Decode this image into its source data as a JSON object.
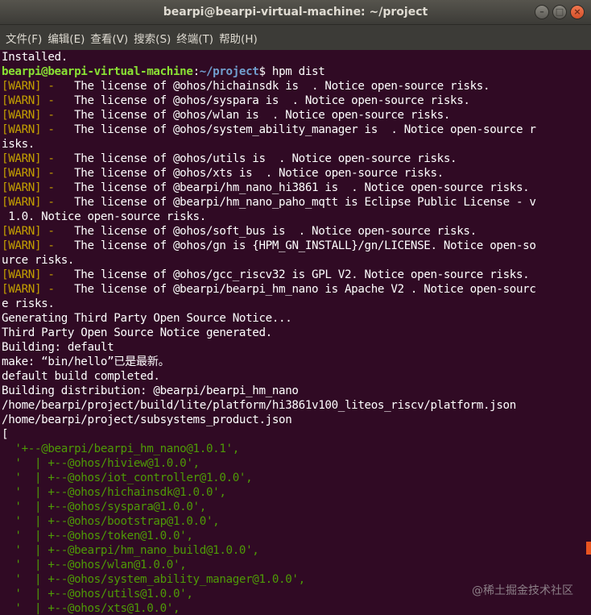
{
  "window": {
    "title": "bearpi@bearpi-virtual-machine: ~/project",
    "minimize_symbol": "–",
    "maximize_symbol": "□",
    "close_symbol": "×"
  },
  "menu": [
    "文件(F)",
    "编辑(E)",
    "查看(V)",
    "搜索(S)",
    "终端(T)",
    "帮助(H)"
  ],
  "colors": {
    "background": "#300a24",
    "warn": "#c4a000",
    "prompt_user": "#8ae234",
    "prompt_path": "#729fcf",
    "tree": "#4e9a06",
    "accent": "#e95420"
  },
  "terminal": {
    "installed": "Installed.",
    "prompt_user": "bearpi@bearpi-virtual-machine",
    "prompt_path": "~/project",
    "command": "$ hpm dist",
    "warn_tag": "[WARN] - ",
    "warn_lines": [
      "  The license of @ohos/hichainsdk is  . Notice open-source risks.",
      "  The license of @ohos/syspara is  . Notice open-source risks.",
      "  The license of @ohos/wlan is  . Notice open-source risks.",
      "  The license of @ohos/system_ability_manager is  . Notice open-source r",
      "  The license of @ohos/utils is  . Notice open-source risks.",
      "  The license of @ohos/xts is  . Notice open-source risks.",
      "  The license of @bearpi/hm_nano_hi3861 is  . Notice open-source risks.",
      "  The license of @bearpi/hm_nano_paho_mqtt is Eclipse Public License - v",
      "  The license of @ohos/soft_bus is  . Notice open-source risks.",
      "  The license of @ohos/gn is {HPM_GN_INSTALL}/gn/LICENSE. Notice open-so",
      "  The license of @ohos/gcc_riscv32 is GPL V2. Notice open-source risks.",
      "  The license of @bearpi/bearpi_hm_nano is Apache V2 . Notice open-sourc"
    ],
    "wraps": [
      "isks.",
      " 1.0. Notice open-source risks.",
      "urce risks.",
      "e risks."
    ],
    "output_lines": [
      "Generating Third Party Open Source Notice...",
      "Third Party Open Source Notice generated.",
      "Building: default",
      "make: “bin/hello”已是最新。",
      "default build completed.",
      "Building distribution: @bearpi/bearpi_hm_nano",
      "/home/bearpi/project/build/lite/platform/hi3861v100_liteos_riscv/platform.json",
      "/home/bearpi/project/subsystems_product.json",
      "["
    ],
    "tree_lines": [
      "  '+--@bearpi/bearpi_hm_nano@1.0.1',",
      "  '  | +--@ohos/hiview@1.0.0',",
      "  '  | +--@ohos/iot_controller@1.0.0',",
      "  '  | +--@ohos/hichainsdk@1.0.0',",
      "  '  | +--@ohos/syspara@1.0.0',",
      "  '  | +--@ohos/bootstrap@1.0.0',",
      "  '  | +--@ohos/token@1.0.0',",
      "  '  | +--@bearpi/hm_nano_build@1.0.0',",
      "  '  | +--@ohos/wlan@1.0.0',",
      "  '  | +--@ohos/system_ability_manager@1.0.0',",
      "  '  | +--@ohos/utils@1.0.0',",
      "  '  | +--@ohos/xts@1.0.0',"
    ]
  },
  "watermark": "@稀土掘金技术社区"
}
